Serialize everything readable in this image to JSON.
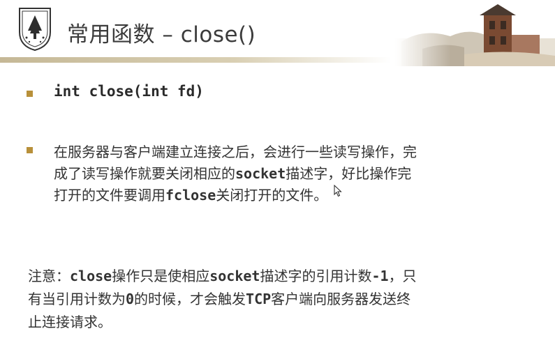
{
  "slide": {
    "title": "常用函数 – close()",
    "bullet1": "int close(int fd)",
    "para": {
      "line1": "在服务器与客户端建立连接之后，会进行一些读写操作，完",
      "line2_a": "成了读写操作就要关闭相应的",
      "line2_code": "socket",
      "line2_b": "描述字，好比操作完",
      "line3_a": "打开的文件要调用",
      "line3_code": "fclose",
      "line3_b": "关闭打开的文件。"
    },
    "note": {
      "line1_a": "注意：",
      "line1_code1": "close",
      "line1_b": "操作只是使相应",
      "line1_code2": "socket",
      "line1_c": "描述字的引用计数",
      "line1_code3": "-1",
      "line1_d": "，只",
      "line2_a": "有当引用计数为",
      "line2_code1": "0",
      "line2_b": "的时候，才会触发",
      "line2_code2": "TCP",
      "line2_c": "客户端向服务器发送终",
      "line3": "止连接请求。"
    }
  },
  "colors": {
    "bullet": "#b8903a",
    "rule": "#c5b896"
  },
  "icons": {
    "logo": "university-seal-icon",
    "banner": "campus-building-image",
    "cursor": "mouse-pointer-icon"
  }
}
